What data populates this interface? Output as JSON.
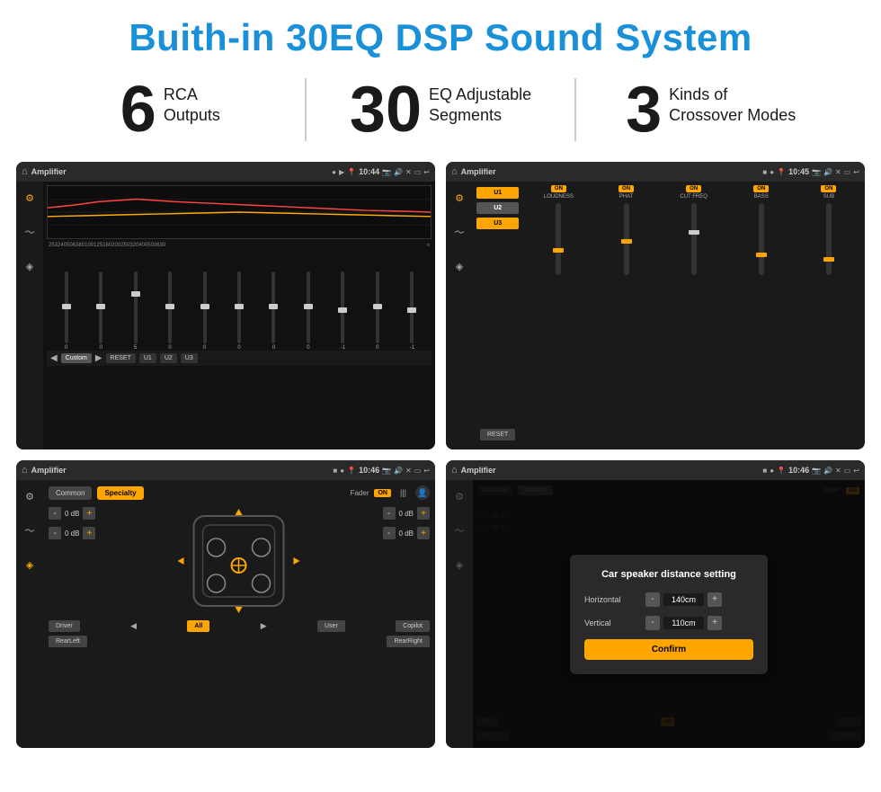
{
  "page": {
    "title": "Buith-in 30EQ DSP Sound System",
    "bg_color": "#ffffff"
  },
  "stats": [
    {
      "number": "6",
      "label": "RCA\nOutputs"
    },
    {
      "number": "30",
      "label": "EQ Adjustable\nSegments"
    },
    {
      "number": "3",
      "label": "Kinds of\nCrossover Modes"
    }
  ],
  "screens": {
    "top_left": {
      "title": "EQ Screen",
      "app": "Amplifier",
      "time": "10:44",
      "freq_labels": [
        "25",
        "32",
        "40",
        "50",
        "63",
        "80",
        "100",
        "125",
        "160",
        "200",
        "250",
        "320",
        "400",
        "500",
        "630"
      ],
      "slider_values": [
        "0",
        "0",
        "0",
        "5",
        "0",
        "0",
        "0",
        "0",
        "0",
        "-1",
        "0",
        "-1"
      ],
      "buttons": [
        "Custom",
        "RESET",
        "U1",
        "U2",
        "U3"
      ]
    },
    "top_right": {
      "title": "Crossover Screen",
      "app": "Amplifier",
      "time": "10:45",
      "u_buttons": [
        "U1",
        "U2",
        "U3"
      ],
      "channels": [
        {
          "on": true,
          "label": "LOUDNESS"
        },
        {
          "on": true,
          "label": "PHAT"
        },
        {
          "on": true,
          "label": "CUT FREQ"
        },
        {
          "on": true,
          "label": "BASS"
        },
        {
          "on": true,
          "label": "SUB"
        }
      ],
      "reset_label": "RESET"
    },
    "bottom_left": {
      "title": "Speaker Layout Screen",
      "app": "Amplifier",
      "time": "10:46",
      "tabs": [
        "Common",
        "Specialty"
      ],
      "fader_label": "Fader",
      "on_badge": "ON",
      "db_values": [
        "0 dB",
        "0 dB",
        "0 dB",
        "0 dB"
      ],
      "speaker_positions": [
        "Driver",
        "Copilot",
        "RearLeft",
        "RearRight",
        "All",
        "User"
      ]
    },
    "bottom_right": {
      "title": "Distance Setting Dialog",
      "app": "Amplifier",
      "time": "10:46",
      "dialog": {
        "title": "Car speaker distance setting",
        "horizontal_label": "Horizontal",
        "horizontal_value": "140cm",
        "vertical_label": "Vertical",
        "vertical_value": "110cm",
        "confirm_label": "Confirm"
      },
      "speaker_positions": [
        "Driver",
        "Copilot",
        "RearLeft",
        "RearRight",
        "All",
        "User"
      ]
    }
  },
  "icons": {
    "home": "⌂",
    "location": "📍",
    "volume": "🔊",
    "back": "↩",
    "eq_icon": "≡",
    "wave_icon": "〜",
    "speaker_icon": "◈"
  }
}
